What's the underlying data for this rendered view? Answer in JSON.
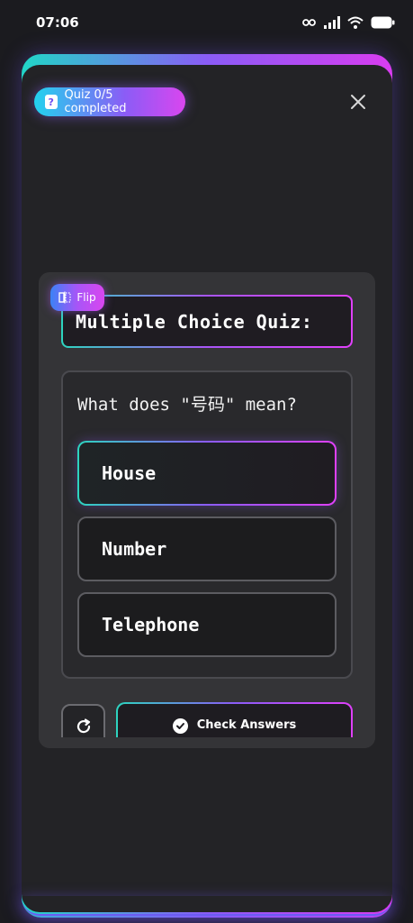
{
  "status_bar": {
    "time": "07:06",
    "icons": [
      "key-icon",
      "signal-icon",
      "wifi-icon",
      "battery-icon"
    ]
  },
  "header": {
    "progress_label": "Quiz 0/5 completed",
    "close_icon": "close-icon"
  },
  "card": {
    "flip_label": "Flip",
    "title": "Multiple Choice Quiz:",
    "question": "What does \"号码\" mean?",
    "options": [
      {
        "label": "House",
        "selected": true
      },
      {
        "label": "Number",
        "selected": false
      },
      {
        "label": "Telephone",
        "selected": false
      }
    ],
    "check_label": "Check Answers"
  },
  "colors": {
    "background": "#1b1b1f",
    "sheet": "#232326",
    "card": "#343437",
    "accent_start": "#22d3ee",
    "accent_mid": "#8b5cf6",
    "accent_end": "#d946ef"
  }
}
